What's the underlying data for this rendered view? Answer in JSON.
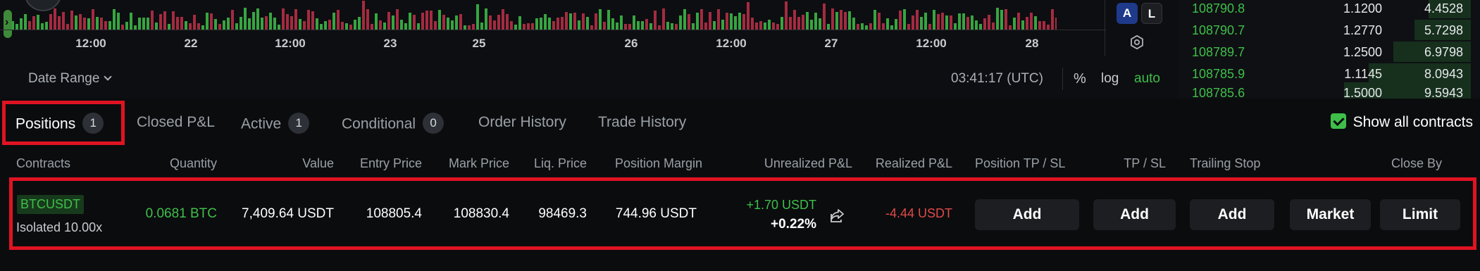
{
  "chart": {
    "x_ticks": [
      "12:00",
      "22",
      "12:00",
      "23",
      "25",
      "26",
      "12:00",
      "27",
      "12:00",
      "28"
    ],
    "scale_buttons": {
      "a": "A",
      "l": "L"
    },
    "date_range_label": "Date Range",
    "clock": "03:41:17 (UTC)",
    "percent_label": "%",
    "log_label": "log",
    "auto_label": "auto",
    "up_color": "#3fbf4a",
    "down_color": "#c0304a"
  },
  "orderbook": {
    "rows": [
      {
        "price": "108790.8",
        "size": "1.1200",
        "total": "4.4528"
      },
      {
        "price": "108790.7",
        "size": "1.2770",
        "total": "5.7298"
      },
      {
        "price": "108789.7",
        "size": "1.2500",
        "total": "6.9798"
      },
      {
        "price": "108785.9",
        "size": "1.1145",
        "total": "8.0943"
      },
      {
        "price": "108785.6",
        "size": "1.5000",
        "total": "9.5943"
      }
    ]
  },
  "tabs": [
    {
      "label": "Positions",
      "count": "1",
      "active": true
    },
    {
      "label": "Closed P&L"
    },
    {
      "label": "Active",
      "count": "1"
    },
    {
      "label": "Conditional",
      "count": "0"
    },
    {
      "label": "Order History"
    },
    {
      "label": "Trade History"
    }
  ],
  "show_all_contracts": {
    "label": "Show all contracts",
    "checked": true
  },
  "columns": [
    "Contracts",
    "Quantity",
    "Value",
    "Entry Price",
    "Mark Price",
    "Liq. Price",
    "Position Margin",
    "Unrealized P&L",
    "Realized P&L",
    "Position TP / SL",
    "TP / SL",
    "Trailing Stop",
    "Close By"
  ],
  "position": {
    "symbol": "BTCUSDT",
    "margin_mode": "Isolated 10.00x",
    "quantity": "0.0681 BTC",
    "value": "7,409.64 USDT",
    "entry_price": "108805.4",
    "mark_price": "108830.4",
    "liq_price": "98469.3",
    "position_margin": "744.96 USDT",
    "unrealized_pnl": "+1.70 USDT",
    "unrealized_pct": "+0.22%",
    "realized_pnl": "-4.44 USDT",
    "buttons": {
      "position_tpsl": "Add",
      "tpsl": "Add",
      "trailing": "Add",
      "market": "Market",
      "limit": "Limit"
    }
  },
  "highlight_color": "#e01323"
}
